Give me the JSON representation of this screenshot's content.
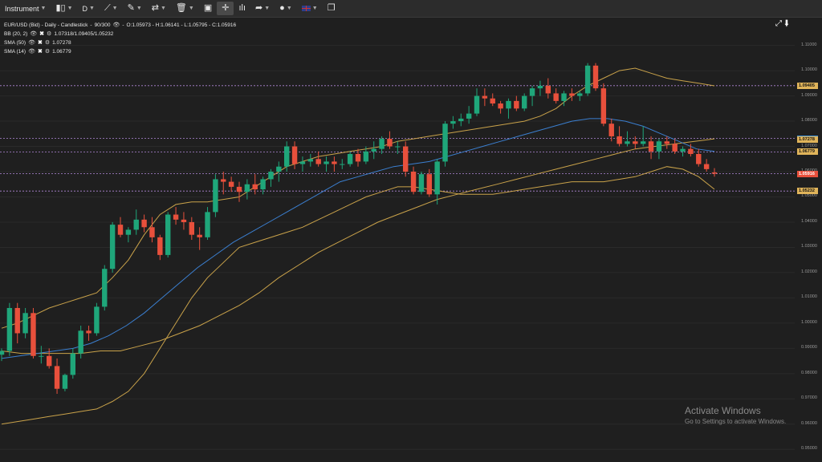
{
  "toolbar": {
    "instrument_label": "Instrument",
    "timeframe_label": "D",
    "items": [
      {
        "icon": "candlestick-icon"
      },
      {
        "icon": "trendline-icon"
      },
      {
        "icon": "ruler-icon"
      },
      {
        "icon": "indicators-icon"
      },
      {
        "icon": "trash-icon"
      },
      {
        "icon": "layout-icon"
      },
      {
        "icon": "crosshair-icon"
      },
      {
        "icon": "arrow-icon"
      },
      {
        "icon": "theme-icon"
      },
      {
        "icon": "uk-flag-icon"
      },
      {
        "icon": "window-icon"
      }
    ]
  },
  "legend": {
    "title": "EUR/USD (Bid) - Daily - Candlestick",
    "bars": "90/300",
    "ohlc": "O:1.05973 - H:1.06141 - L:1.05795 - C:1.05916",
    "bb_name": "BB (20, 2)",
    "bb_values": "1.07318/1.09405/1.05232",
    "sma50_name": "SMA (50)",
    "sma50_value": "1.07278",
    "sma14_name": "SMA (14)",
    "sma14_value": "1.06779"
  },
  "watermark": {
    "title": "Activate Windows",
    "subtitle": "Go to Settings to activate Windows."
  },
  "price_labels": [
    {
      "text": "1.09405",
      "color": "#e0b45a",
      "y": 1.09405
    },
    {
      "text": "1.07318",
      "color": "#3b8fd6",
      "y": 1.07318
    },
    {
      "text": "1.07278",
      "color": "#e0b45a",
      "y": 1.07278
    },
    {
      "text": "1.06779",
      "color": "#e0b45a",
      "y": 1.06779
    },
    {
      "text": "1.05916",
      "color": "#e8503c",
      "y": 1.05916
    },
    {
      "text": "1.05232",
      "color": "#e0b45a",
      "y": 1.05232
    }
  ],
  "chart_data": {
    "type": "candlestick",
    "title": "EUR/USD (Bid) - Daily - Candlestick",
    "ylim": [
      0.945,
      1.121
    ],
    "yticks": [
      "1.11000",
      "1.10000",
      "1.09000",
      "1.08000",
      "1.07000",
      "1.06000",
      "1.05000",
      "1.04000",
      "1.03000",
      "1.02000",
      "1.01000",
      "1.00000",
      "0.99000",
      "0.98000",
      "0.97000",
      "0.96000",
      "0.95000"
    ],
    "ytick_values": [
      1.11,
      1.1,
      1.09,
      1.08,
      1.07,
      1.06,
      1.05,
      1.04,
      1.03,
      1.02,
      1.01,
      1.0,
      0.99,
      0.98,
      0.97,
      0.96,
      0.95
    ],
    "horizontal_lines": [
      1.09405,
      1.07318,
      1.06779,
      1.05916,
      1.05232
    ],
    "colors": {
      "up": "#1fa67a",
      "down": "#e8503c",
      "bb": "#c9a24a",
      "sma50": "#c9a24a",
      "sma14": "#3b7fd0",
      "hline": "#b088d8"
    },
    "candles": [
      [
        0.9875,
        0.99,
        0.985,
        0.989
      ],
      [
        0.989,
        1.008,
        0.987,
        1.006
      ],
      [
        1.006,
        1.008,
        0.992,
        0.996
      ],
      [
        0.996,
        1.006,
        0.994,
        1.004
      ],
      [
        1.004,
        1.006,
        0.986,
        0.987
      ],
      [
        0.987,
        0.991,
        0.984,
        0.987
      ],
      [
        0.987,
        0.99,
        0.982,
        0.983
      ],
      [
        0.983,
        0.986,
        0.972,
        0.974
      ],
      [
        0.974,
        0.98,
        0.973,
        0.9795
      ],
      [
        0.9795,
        0.99,
        0.978,
        0.988
      ],
      [
        0.988,
        0.999,
        0.986,
        0.997
      ],
      [
        0.997,
        0.999,
        0.993,
        0.996
      ],
      [
        0.996,
        1.008,
        0.995,
        1.0065
      ],
      [
        1.0065,
        1.023,
        1.005,
        1.0215
      ],
      [
        1.0215,
        1.04,
        1.02,
        1.039
      ],
      [
        1.039,
        1.042,
        1.034,
        1.035
      ],
      [
        1.035,
        1.038,
        1.032,
        1.037
      ],
      [
        1.037,
        1.045,
        1.035,
        1.041
      ],
      [
        1.041,
        1.043,
        1.036,
        1.038
      ],
      [
        1.038,
        1.042,
        1.032,
        1.034
      ],
      [
        1.034,
        1.035,
        1.025,
        1.027
      ],
      [
        1.027,
        1.044,
        1.026,
        1.043
      ],
      [
        1.043,
        1.046,
        1.039,
        1.041
      ],
      [
        1.041,
        1.044,
        1.037,
        1.04
      ],
      [
        1.04,
        1.042,
        1.033,
        1.035
      ],
      [
        1.035,
        1.038,
        1.029,
        1.034
      ],
      [
        1.034,
        1.046,
        1.033,
        1.044
      ],
      [
        1.044,
        1.059,
        1.042,
        1.057
      ],
      [
        1.057,
        1.06,
        1.051,
        1.056
      ],
      [
        1.056,
        1.058,
        1.052,
        1.054
      ],
      [
        1.054,
        1.056,
        1.048,
        1.052
      ],
      [
        1.052,
        1.057,
        1.049,
        1.055
      ],
      [
        1.055,
        1.059,
        1.051,
        1.053
      ],
      [
        1.053,
        1.058,
        1.051,
        1.057
      ],
      [
        1.057,
        1.061,
        1.054,
        1.06
      ],
      [
        1.06,
        1.064,
        1.056,
        1.062
      ],
      [
        1.062,
        1.072,
        1.06,
        1.07
      ],
      [
        1.07,
        1.072,
        1.061,
        1.063
      ],
      [
        1.063,
        1.066,
        1.06,
        1.064
      ],
      [
        1.064,
        1.067,
        1.062,
        1.065
      ],
      [
        1.065,
        1.068,
        1.062,
        1.063
      ],
      [
        1.063,
        1.066,
        1.06,
        1.064
      ],
      [
        1.064,
        1.066,
        1.06,
        1.063
      ],
      [
        1.063,
        1.065,
        1.061,
        1.063
      ],
      [
        1.063,
        1.068,
        1.062,
        1.067
      ],
      [
        1.067,
        1.069,
        1.062,
        1.064
      ],
      [
        1.064,
        1.07,
        1.063,
        1.068
      ],
      [
        1.068,
        1.072,
        1.065,
        1.069
      ],
      [
        1.069,
        1.074,
        1.067,
        1.073
      ],
      [
        1.073,
        1.076,
        1.069,
        1.07
      ],
      [
        1.07,
        1.072,
        1.067,
        1.07
      ],
      [
        1.07,
        1.072,
        1.058,
        1.06
      ],
      [
        1.06,
        1.062,
        1.051,
        1.052
      ],
      [
        1.052,
        1.06,
        1.051,
        1.059
      ],
      [
        1.059,
        1.061,
        1.05,
        1.051
      ],
      [
        1.051,
        1.065,
        1.047,
        1.064
      ],
      [
        1.064,
        1.08,
        1.062,
        1.079
      ],
      [
        1.079,
        1.082,
        1.077,
        1.08
      ],
      [
        1.08,
        1.083,
        1.078,
        1.081
      ],
      [
        1.081,
        1.086,
        1.079,
        1.083
      ],
      [
        1.083,
        1.093,
        1.082,
        1.09
      ],
      [
        1.09,
        1.093,
        1.086,
        1.089
      ],
      [
        1.089,
        1.091,
        1.086,
        1.087
      ],
      [
        1.087,
        1.088,
        1.083,
        1.085
      ],
      [
        1.085,
        1.089,
        1.081,
        1.088
      ],
      [
        1.088,
        1.09,
        1.084,
        1.085
      ],
      [
        1.085,
        1.091,
        1.084,
        1.09
      ],
      [
        1.09,
        1.094,
        1.086,
        1.093
      ],
      [
        1.093,
        1.096,
        1.09,
        1.094
      ],
      [
        1.094,
        1.097,
        1.089,
        1.091
      ],
      [
        1.091,
        1.093,
        1.087,
        1.088
      ],
      [
        1.088,
        1.092,
        1.086,
        1.091
      ],
      [
        1.091,
        1.093,
        1.088,
        1.09
      ],
      [
        1.09,
        1.092,
        1.088,
        1.091
      ],
      [
        1.091,
        1.103,
        1.09,
        1.102
      ],
      [
        1.102,
        1.103,
        1.092,
        1.093
      ],
      [
        1.093,
        1.095,
        1.078,
        1.079
      ],
      [
        1.079,
        1.081,
        1.072,
        1.074
      ],
      [
        1.074,
        1.078,
        1.07,
        1.071
      ],
      [
        1.071,
        1.076,
        1.07,
        1.072
      ],
      [
        1.072,
        1.074,
        1.069,
        1.071
      ],
      [
        1.071,
        1.078,
        1.07,
        1.072
      ],
      [
        1.072,
        1.074,
        1.065,
        1.068
      ],
      [
        1.068,
        1.073,
        1.065,
        1.072
      ],
      [
        1.072,
        1.074,
        1.069,
        1.071
      ],
      [
        1.071,
        1.073,
        1.067,
        1.068
      ],
      [
        1.068,
        1.07,
        1.066,
        1.069
      ],
      [
        1.069,
        1.071,
        1.066,
        1.067
      ],
      [
        1.067,
        1.069,
        1.062,
        1.063
      ],
      [
        1.063,
        1.065,
        1.06,
        1.061
      ],
      [
        1.0597,
        1.0614,
        1.058,
        1.0592
      ]
    ],
    "series": [
      {
        "name": "BB (20, 2) upper",
        "values": [
          0.998,
          1.0,
          1.003,
          1.006,
          1.008,
          1.01,
          1.012,
          1.018,
          1.025,
          1.035,
          1.043,
          1.047,
          1.048,
          1.048,
          1.049,
          1.05,
          1.054,
          1.058,
          1.062,
          1.064,
          1.066,
          1.067,
          1.068,
          1.069,
          1.07,
          1.072,
          1.073,
          1.074,
          1.075,
          1.076,
          1.077,
          1.078,
          1.079,
          1.08,
          1.082,
          1.085,
          1.09,
          1.094,
          1.097,
          1.1,
          1.101,
          1.099,
          1.097,
          1.096,
          1.095,
          1.094
        ]
      },
      {
        "name": "BB (20, 2) lower",
        "values": [
          0.96,
          0.961,
          0.962,
          0.963,
          0.964,
          0.965,
          0.966,
          0.969,
          0.973,
          0.98,
          0.99,
          1.0,
          1.01,
          1.018,
          1.024,
          1.03,
          1.032,
          1.034,
          1.036,
          1.038,
          1.041,
          1.044,
          1.047,
          1.05,
          1.052,
          1.054,
          1.054,
          1.053,
          1.052,
          1.051,
          1.051,
          1.051,
          1.052,
          1.053,
          1.054,
          1.055,
          1.056,
          1.056,
          1.056,
          1.057,
          1.058,
          1.06,
          1.062,
          1.061,
          1.058,
          1.053
        ]
      },
      {
        "name": "SMA (50)",
        "values": [
          0.989,
          0.988,
          0.988,
          0.988,
          0.988,
          0.989,
          0.989,
          0.991,
          0.993,
          0.996,
          0.999,
          1.003,
          1.007,
          1.012,
          1.018,
          1.023,
          1.028,
          1.032,
          1.036,
          1.04,
          1.043,
          1.046,
          1.049,
          1.051,
          1.053,
          1.055,
          1.057,
          1.059,
          1.061,
          1.063,
          1.065,
          1.067,
          1.069,
          1.07,
          1.071,
          1.072,
          1.073
        ]
      },
      {
        "name": "SMA (14)",
        "values": [
          0.986,
          0.987,
          0.988,
          0.989,
          0.99,
          0.992,
          0.995,
          0.999,
          1.004,
          1.01,
          1.016,
          1.022,
          1.027,
          1.032,
          1.036,
          1.04,
          1.044,
          1.048,
          1.052,
          1.056,
          1.058,
          1.06,
          1.062,
          1.063,
          1.064,
          1.066,
          1.068,
          1.07,
          1.072,
          1.074,
          1.076,
          1.078,
          1.08,
          1.081,
          1.081,
          1.08,
          1.078,
          1.075,
          1.072,
          1.069,
          1.068
        ]
      }
    ]
  }
}
